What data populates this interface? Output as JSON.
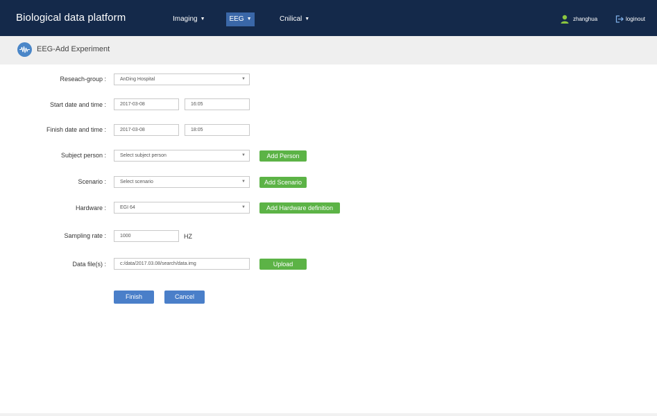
{
  "header": {
    "brand": "Biological data platform",
    "nav": [
      {
        "label": "Imaging",
        "caret": "▼"
      },
      {
        "label": "EEG",
        "caret": "▼"
      },
      {
        "label": "Cnilical",
        "caret": "▼"
      }
    ],
    "user": {
      "name": "zhanghua",
      "icon": "user-icon"
    },
    "logout": {
      "label": "loginout",
      "icon": "logout-icon"
    }
  },
  "subheader": {
    "title": "EEG-Add Experiment",
    "icon": "eeg-wave-icon"
  },
  "form": {
    "research_group": {
      "label": "Reseach-group :",
      "value": "AnDing Hospital"
    },
    "start": {
      "label": "Start date and time :",
      "date": "2017-03-08",
      "time": "16:05"
    },
    "finish": {
      "label": "Finish date and time :",
      "date": "2017-03-08",
      "time": "18:05"
    },
    "subject": {
      "label": "Subject person :",
      "placeholder": "Select subject person",
      "button": "Add Person"
    },
    "scenario": {
      "label": "Scenario :",
      "placeholder": "Select scenario",
      "button": "Add Scenario"
    },
    "hardware": {
      "label": "Hardware :",
      "value": "EGI 64",
      "button": "Add Hardware definition"
    },
    "sampling": {
      "label": "Sampling rate :",
      "value": "1000",
      "unit": "HZ"
    },
    "datafile": {
      "label": "Data file(s) :",
      "value": "c:/data/2017.03.08/search/data.img",
      "button": "Upload"
    },
    "finish_button": "Finish",
    "cancel_button": "Cancel"
  },
  "colors": {
    "header_bg": "#14294a",
    "nav_active": "#3a67a8",
    "green_button": "#5cb346",
    "blue_button": "#4a7fc9"
  }
}
